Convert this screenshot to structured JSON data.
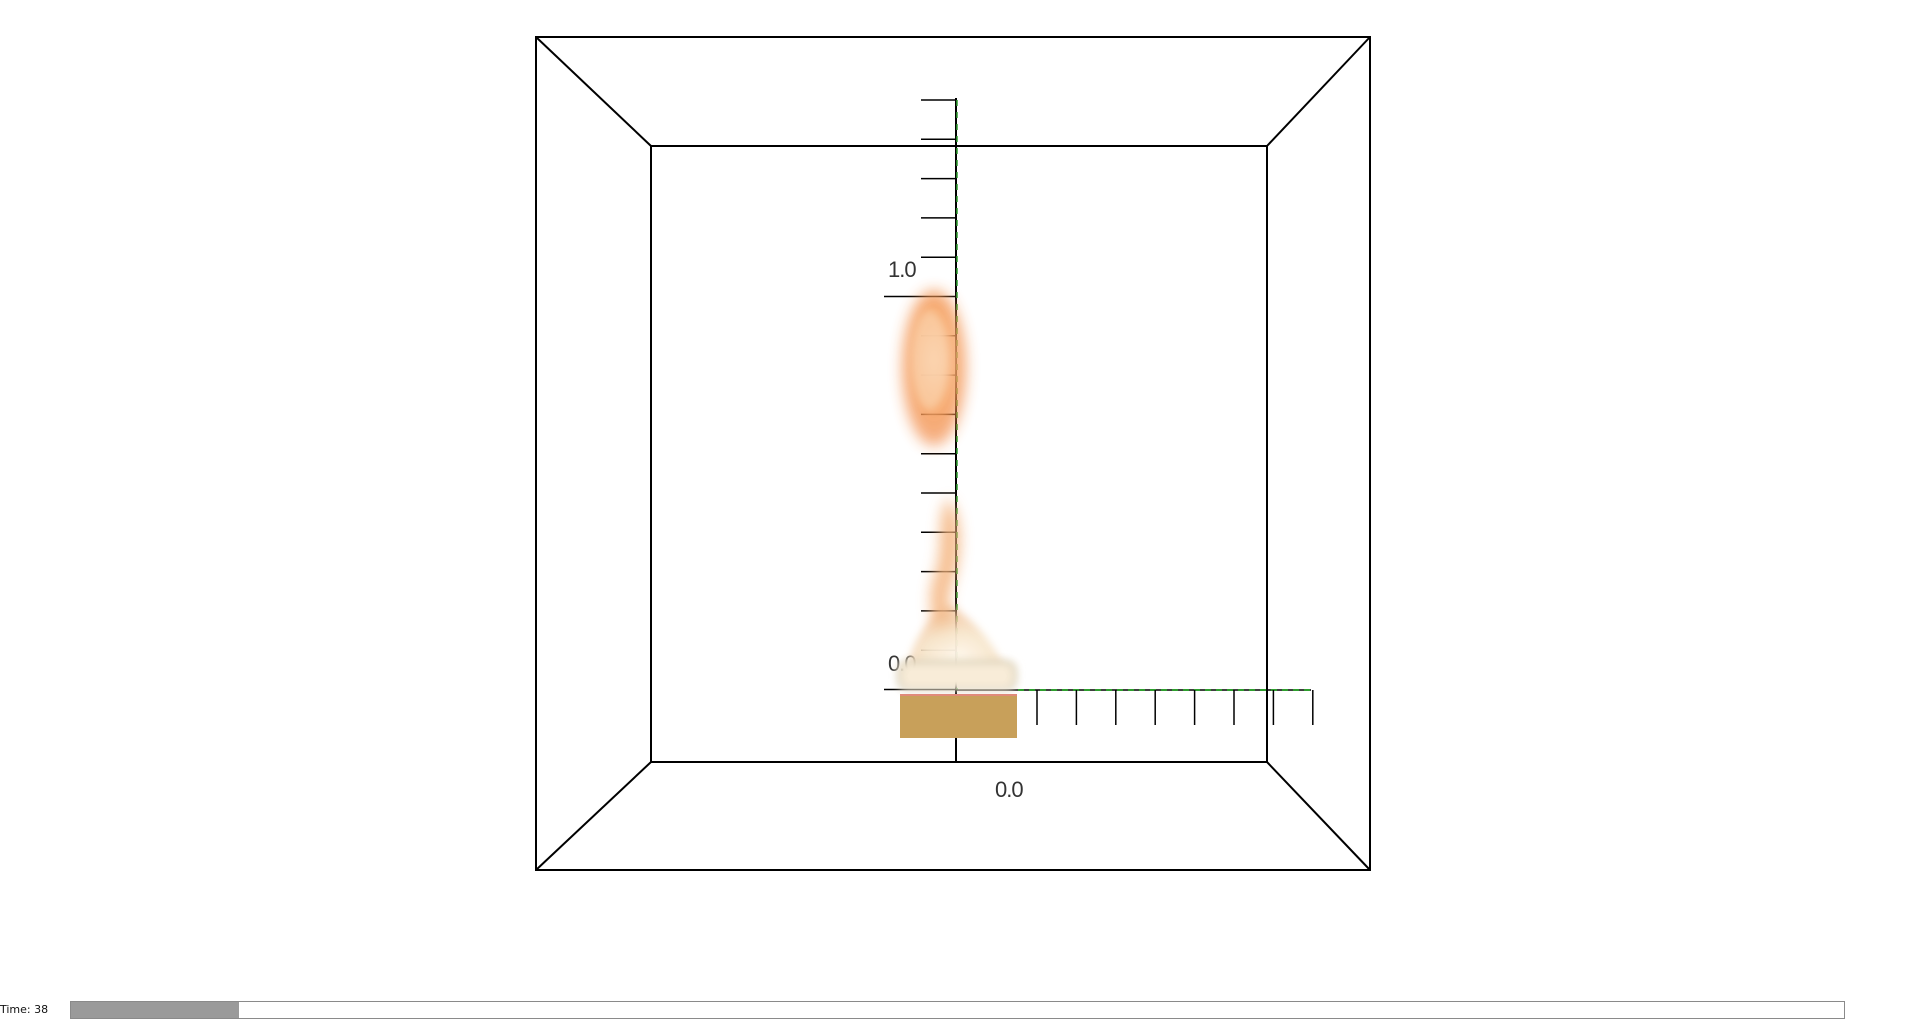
{
  "scene": {
    "background_color": "#ffffff",
    "box_color": "#000000",
    "axis_dash_color": "#2e9e2e",
    "flame_color": "#f07a30",
    "burner_color": "#c8a05a",
    "axis_labels": {
      "vertical_top": "1.0",
      "vertical_bottom": "0.0",
      "horizontal_origin": "0.0"
    }
  },
  "timeline": {
    "label": "Time:",
    "value": "38",
    "progress_fraction": 0.095,
    "fill_color": "#9a9a9a"
  }
}
